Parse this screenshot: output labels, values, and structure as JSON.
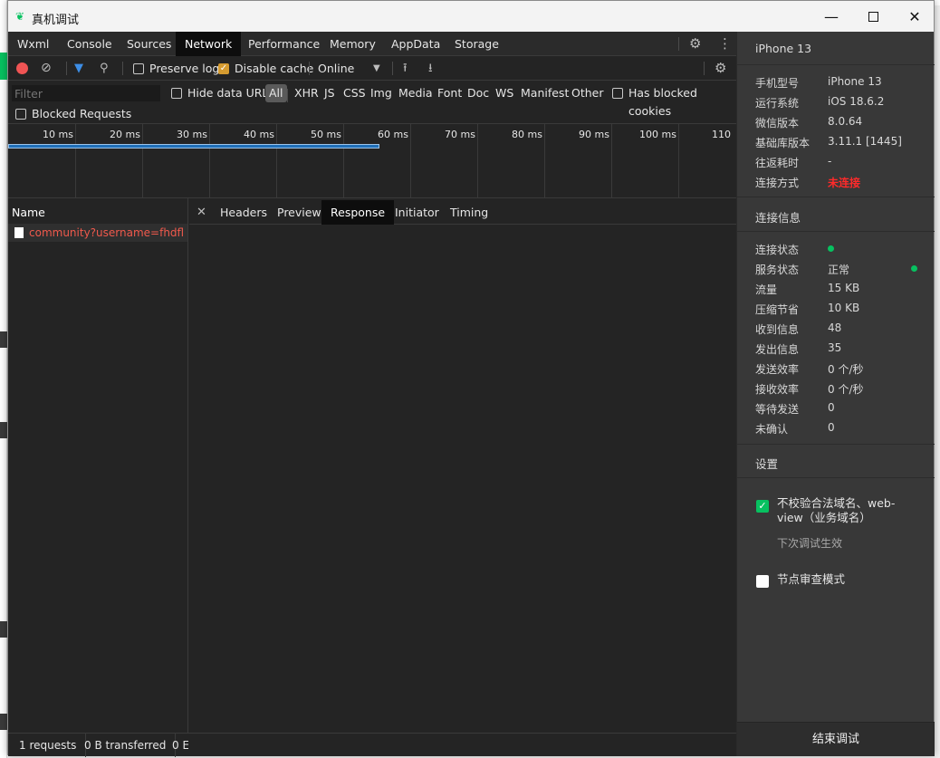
{
  "window": {
    "title": "真机调试"
  },
  "tabs": [
    "Wxml",
    "Console",
    "Sources",
    "Network",
    "Performance",
    "Memory",
    "AppData",
    "Storage"
  ],
  "active_tab": "Network",
  "toolbar": {
    "preserve_log": "Preserve log",
    "disable_cache": "Disable cache",
    "throttle": "Online"
  },
  "filterbar": {
    "filter_placeholder": "Filter",
    "hide_data_urls": "Hide data URLs",
    "all": "All",
    "types": [
      "XHR",
      "JS",
      "CSS",
      "Img",
      "Media",
      "Font",
      "Doc",
      "WS",
      "Manifest",
      "Other"
    ],
    "has_blocked_cookies": "Has blocked cookies",
    "blocked_requests": "Blocked Requests"
  },
  "timeline": {
    "labels": [
      "10 ms",
      "20 ms",
      "30 ms",
      "40 ms",
      "50 ms",
      "60 ms",
      "70 ms",
      "80 ms",
      "90 ms",
      "100 ms",
      "110"
    ]
  },
  "requests": {
    "header": "Name",
    "items": [
      "community?username=fhdfl"
    ]
  },
  "detail_tabs": [
    "Headers",
    "Preview",
    "Response",
    "Initiator",
    "Timing"
  ],
  "active_detail_tab": "Response",
  "status": {
    "requests": "1 requests",
    "transferred": "0 B transferred",
    "resources": "0 E"
  },
  "side": {
    "device_title": "iPhone 13",
    "device_info": [
      {
        "k": "手机型号",
        "v": "iPhone 13"
      },
      {
        "k": "运行系统",
        "v": "iOS 18.6.2"
      },
      {
        "k": "微信版本",
        "v": "8.0.64"
      },
      {
        "k": "基础库版本",
        "v": "3.11.1 [1445]"
      },
      {
        "k": "往返耗时",
        "v": "-"
      },
      {
        "k": "连接方式",
        "v": "未连接"
      }
    ],
    "conn_title": "连接信息",
    "conn_info": [
      {
        "k": "连接状态",
        "v": ""
      },
      {
        "k": "服务状态",
        "v": "正常"
      },
      {
        "k": "流量",
        "v": "15 KB"
      },
      {
        "k": "压缩节省",
        "v": "10 KB"
      },
      {
        "k": "收到信息",
        "v": "48"
      },
      {
        "k": "发出信息",
        "v": "35"
      },
      {
        "k": "发送效率",
        "v": "0 个/秒"
      },
      {
        "k": "接收效率",
        "v": "0 个/秒"
      },
      {
        "k": "等待发送",
        "v": "0"
      },
      {
        "k": "未确认",
        "v": "0"
      }
    ],
    "settings_title": "设置",
    "option1_line1": "不校验合法域名、web-",
    "option1_line2": "view（业务域名）",
    "option1_note": "下次调试生效",
    "option2": "节点审查模式",
    "end_button": "结束调试"
  },
  "colors": {
    "accent_green": "#07c160",
    "record_red": "#f05454",
    "request_name": "#f0594c",
    "not_connected": "#ff2a2a"
  }
}
